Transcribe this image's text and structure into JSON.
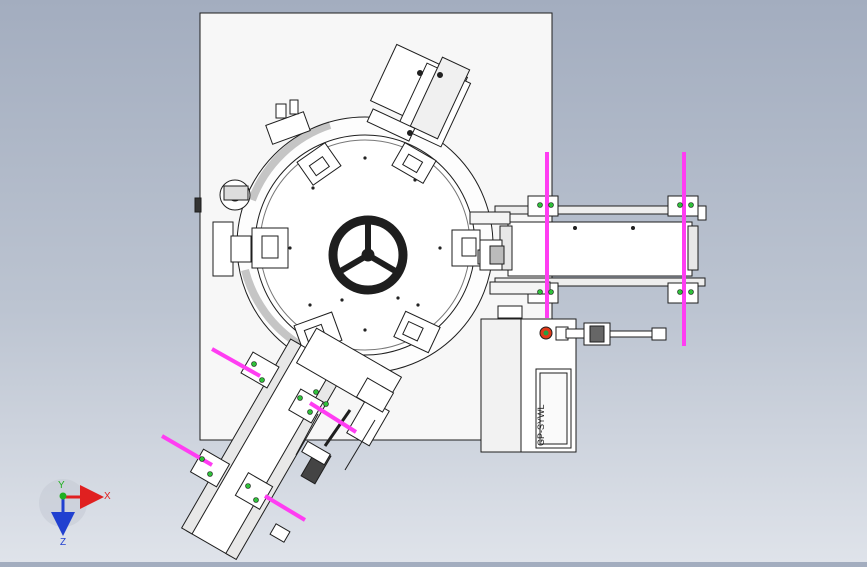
{
  "panel": {
    "label": "GP-SYWL"
  },
  "axes": {
    "x_label": "X",
    "y_label": "Y",
    "z_label": "Z"
  },
  "colors": {
    "background_top": "#a3adbf",
    "background_bottom": "#dfe3ea",
    "line": "#1e1e1e",
    "part_fill": "#ffffff",
    "rod": "#ff3df2",
    "fastener": "#2fbf3a",
    "axis_x": "#e02020",
    "axis_y": "#20b020",
    "axis_z": "#2040d0",
    "indicator_red": "#e23a1a",
    "indicator_green": "#25a040"
  },
  "icons": [
    "handwheel-icon",
    "axis-triad-icon"
  ]
}
